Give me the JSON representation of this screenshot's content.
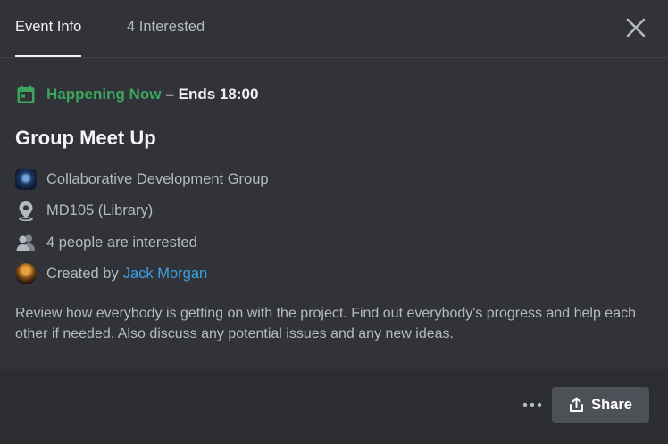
{
  "tabs": {
    "event_info": "Event Info",
    "interested": "4 Interested"
  },
  "status": {
    "now": "Happening Now",
    "ends": "– Ends 18:00",
    "color": "#3ba55d"
  },
  "event": {
    "title": "Group Meet Up",
    "server": "Collaborative Development Group",
    "location": "MD105 (Library)",
    "interested": "4 people are interested",
    "created_by_label": "Created by",
    "creator": "Jack Morgan",
    "description": "Review how everybody is getting on with the project. Find out everybody's progress and help each other if needed. Also discuss any potential issues and any new ideas."
  },
  "footer": {
    "share_label": "Share"
  },
  "icons": [
    "calendar-icon",
    "close-icon",
    "location-pin-icon",
    "people-icon",
    "more-icon",
    "share-icon"
  ]
}
